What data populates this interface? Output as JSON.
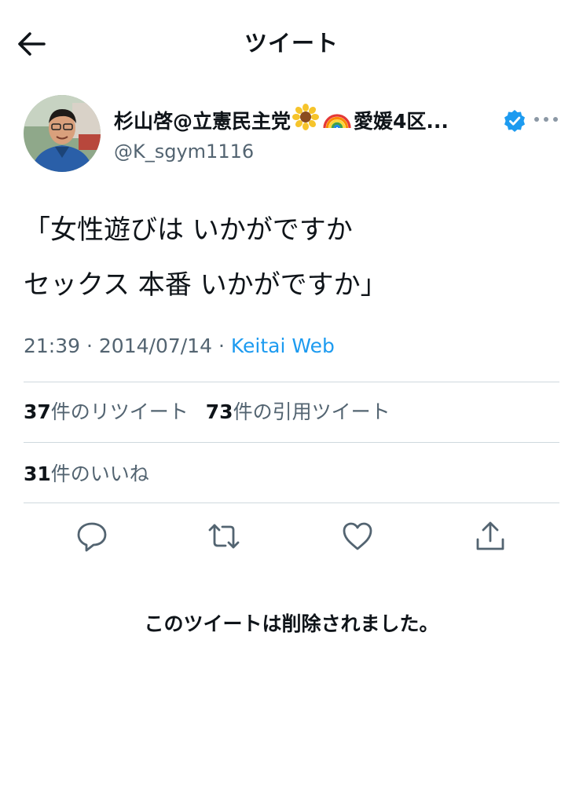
{
  "header": {
    "title": "ツイート",
    "back_icon": "arrow-left-icon"
  },
  "author": {
    "name_prefix": "杉山啓@立憲民主党",
    "name_emoji_1": "sunflower-icon",
    "name_emoji_2": "rainbow-icon",
    "name_suffix": "愛媛4区...",
    "handle": "@K_sgym1116",
    "verified": true
  },
  "tweet": {
    "lines": [
      "「女性遊びは いかがですか",
      "セックス 本番 いかがですか」"
    ],
    "time": "21:39",
    "date": "2014/07/14",
    "separator": "·",
    "source": "Keitai Web"
  },
  "stats": {
    "retweets_count": "37",
    "retweets_label": "件のリツイート",
    "quotes_count": "73",
    "quotes_label": "件の引用ツイート",
    "likes_count": "31",
    "likes_label": "件のいいね"
  },
  "actions": [
    "reply-icon",
    "retweet-icon",
    "like-icon",
    "share-icon"
  ],
  "deleted_message": "このツイートは削除されました。",
  "colors": {
    "accent": "#1d9bf0",
    "secondary_text": "#536471",
    "divider": "#cfd9de",
    "text": "#0f1419"
  }
}
